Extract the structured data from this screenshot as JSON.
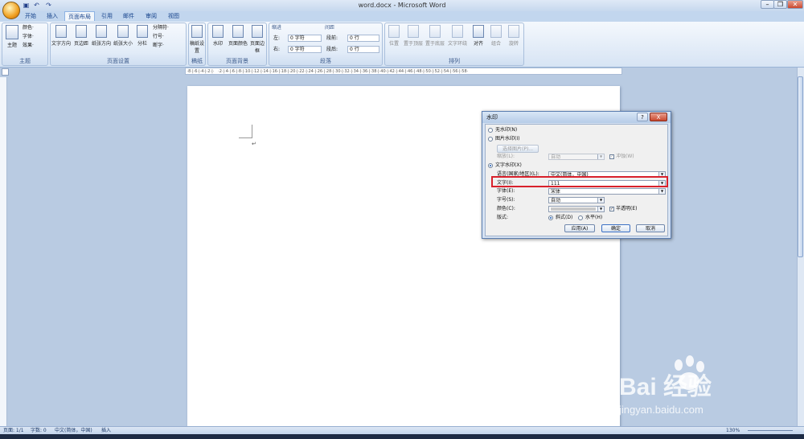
{
  "window": {
    "title": "word.docx - Microsoft Word"
  },
  "tabs": [
    "开始",
    "插入",
    "页面布局",
    "引用",
    "邮件",
    "审阅",
    "视图"
  ],
  "active_tab": "页面布局",
  "ribbon": {
    "theme": {
      "big_label": "主题",
      "small": [
        "颜色·",
        "字体·",
        "效果·"
      ],
      "group_label": "主题"
    },
    "page_setup": {
      "buttons": [
        "文字方向",
        "页边距",
        "纸张方向",
        "纸张大小",
        "分栏"
      ],
      "small": [
        "分隔符·",
        "行号·",
        "断字·"
      ],
      "group_label": "页面设置"
    },
    "draft": {
      "buttons": [
        "稿纸设置"
      ],
      "group_label": "稿纸"
    },
    "page_background": {
      "buttons": [
        "水印",
        "页面颜色",
        "页面边框"
      ],
      "group_label": "页面背景"
    },
    "paragraph": {
      "indent_label": "缩进",
      "spacing_label": "间距",
      "left_label": "左:",
      "right_label": "右:",
      "before_label": "段前:",
      "after_label": "段后:",
      "left_value": "0 字符",
      "right_value": "0 字符",
      "before_value": "0 行",
      "after_value": "0 行",
      "group_label": "段落"
    },
    "arrange": {
      "buttons": [
        "位置",
        "置于顶层",
        "置于底层",
        "文字环绕",
        "对齐",
        "组合",
        "旋转"
      ],
      "group_label": "排列"
    }
  },
  "dialog": {
    "title": "水印",
    "close_label": "X",
    "no_watermark": "无水印(N)",
    "picture_watermark": "图片水印(I)",
    "select_picture": "选择图片(P)...",
    "scale_label": "缩放(L):",
    "scale_value": "自动",
    "washout_label": "冲蚀(W)",
    "text_watermark": "文字水印(X)",
    "language_label": "语言(国家/地区)(L):",
    "language_value": "中文(简体，中国)",
    "text_label": "文字(I):",
    "text_value": "111",
    "font_label": "字体(E):",
    "font_value": "宋体",
    "size_label": "字号(S):",
    "size_value": "自动",
    "color_label": "颜色(C):",
    "semitransparent_label": "半透明(E)",
    "layout_label": "版式:",
    "diagonal_label": "斜式(D)",
    "horizontal_label": "水平(H)",
    "apply_button": "应用(A)",
    "ok_button": "确定",
    "cancel_button": "取消"
  },
  "statusbar": {
    "page": "页面: 1/1",
    "words": "字数: 0",
    "language": "中文(简体，中国)",
    "mode": "插入",
    "zoom": "130%"
  },
  "watermark_site": {
    "logo_text": "Bai 经验",
    "url": "jingyan.baidu.com"
  }
}
